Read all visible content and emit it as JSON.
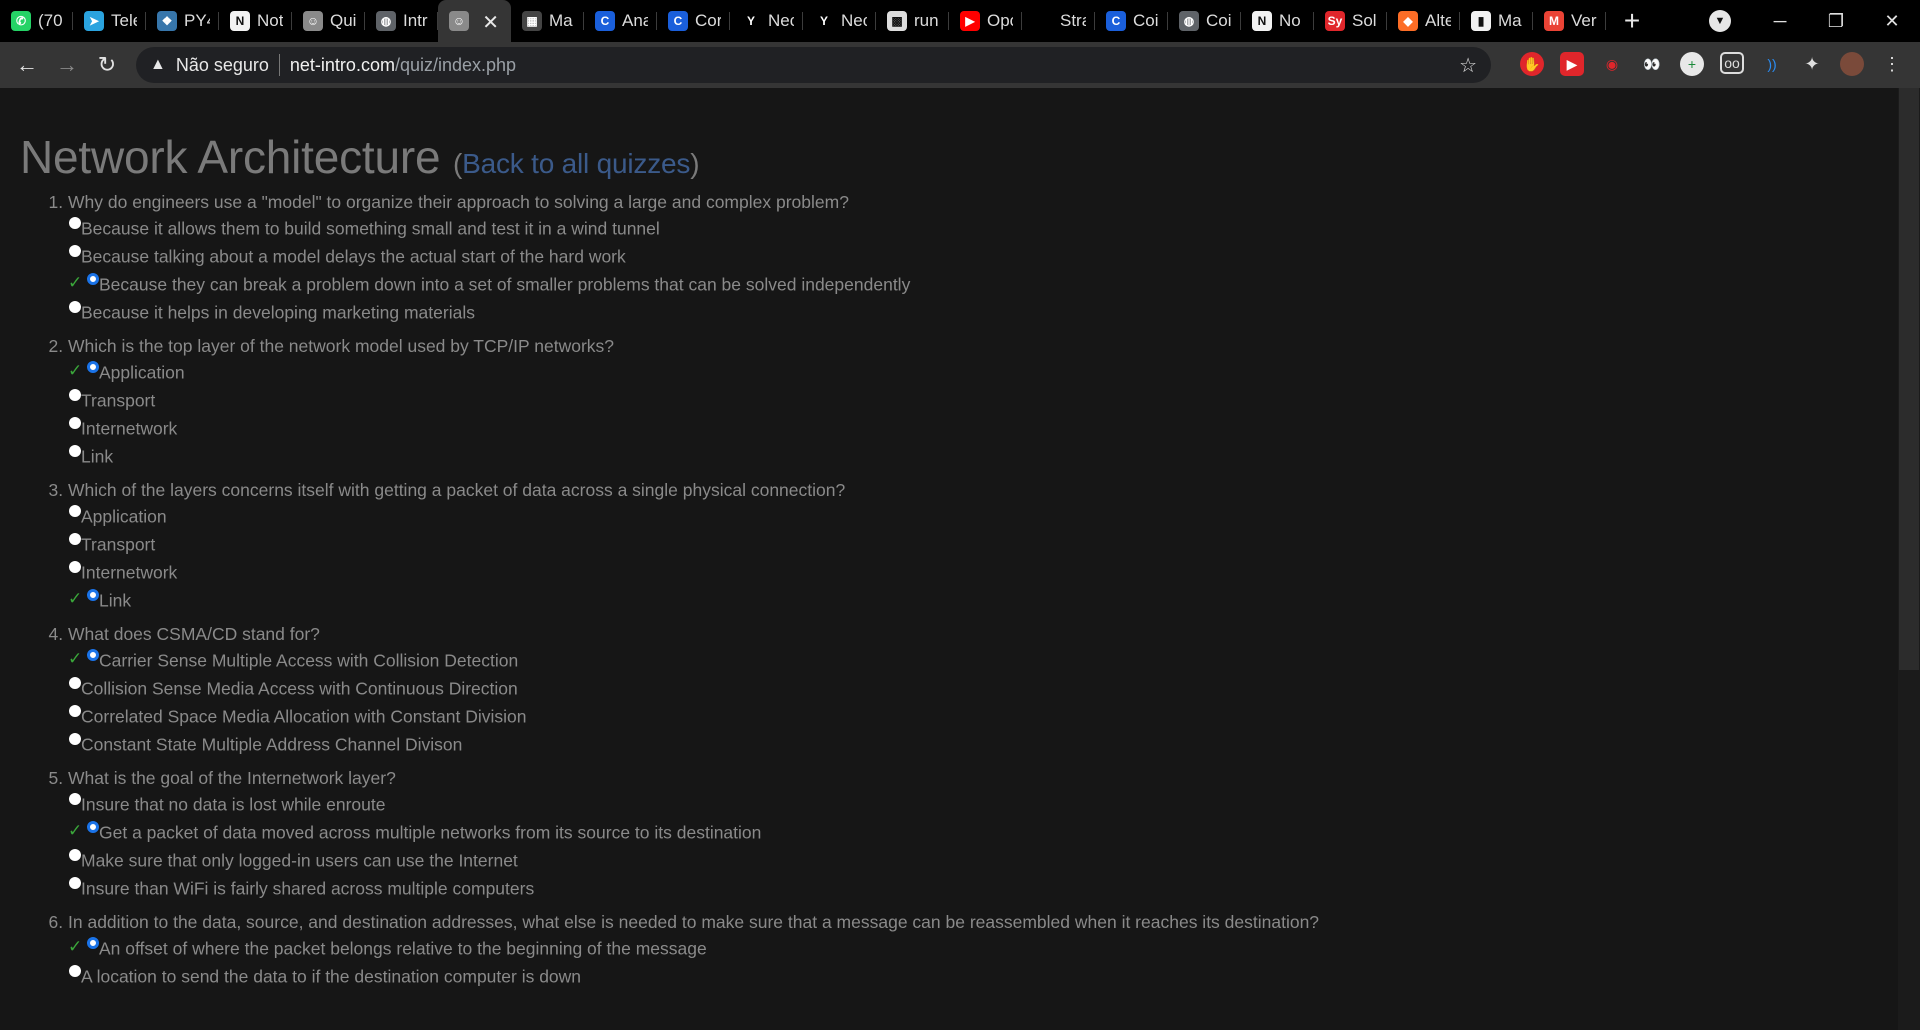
{
  "browser": {
    "tabs": [
      {
        "title": "(70",
        "favicon": "whatsapp-icon",
        "color": "#25d366",
        "glyph": "✆"
      },
      {
        "title": "Tele",
        "favicon": "telegram-icon",
        "color": "#2aa3df",
        "glyph": "➤"
      },
      {
        "title": "PY4",
        "favicon": "python-icon",
        "color": "#3776ab",
        "glyph": "❖"
      },
      {
        "title": "Not",
        "favicon": "notion-icon",
        "color": "#f2f2f2",
        "glyph": "N"
      },
      {
        "title": "Qui",
        "favicon": "avatar-icon",
        "color": "#8a8a8a",
        "glyph": "☺"
      },
      {
        "title": "Intr",
        "favicon": "globe-icon",
        "color": "#5f6368",
        "glyph": "◍"
      },
      {
        "title": "",
        "favicon": "avatar-icon",
        "color": "#8a8a8a",
        "glyph": "☺",
        "active": true
      },
      {
        "title": "Ma",
        "favicon": "film-icon",
        "color": "#444",
        "glyph": "▦"
      },
      {
        "title": "Ana",
        "favicon": "c-icon",
        "color": "#1a5fdb",
        "glyph": "C"
      },
      {
        "title": "Cor",
        "favicon": "c-icon",
        "color": "#1a5fdb",
        "glyph": "C"
      },
      {
        "title": "Nec",
        "favicon": "y-icon",
        "color": "#000",
        "glyph": "Y"
      },
      {
        "title": "Nec",
        "favicon": "y-icon",
        "color": "#000",
        "glyph": "Y"
      },
      {
        "title": "run",
        "favicon": "qr-icon",
        "color": "#ddd",
        "glyph": "▩"
      },
      {
        "title": "Opc",
        "favicon": "youtube-icon",
        "color": "#ff0000",
        "glyph": "▶"
      },
      {
        "title": "Stra",
        "favicon": "blank-icon",
        "color": "#000",
        "glyph": ""
      },
      {
        "title": "Coi",
        "favicon": "c-icon",
        "color": "#1a5fdb",
        "glyph": "C"
      },
      {
        "title": "Coi",
        "favicon": "globe-icon",
        "color": "#5f6368",
        "glyph": "◍"
      },
      {
        "title": "No",
        "favicon": "notion-icon",
        "color": "#f2f2f2",
        "glyph": "N"
      },
      {
        "title": "Sol",
        "favicon": "sy-icon",
        "color": "#e0262b",
        "glyph": "Sy"
      },
      {
        "title": "Alte",
        "favicon": "gitlab-icon",
        "color": "#fc6d26",
        "glyph": "◆"
      },
      {
        "title": "Ma",
        "favicon": "bookmark-icon",
        "color": "#f2f2f2",
        "glyph": "▮"
      },
      {
        "title": "Ver",
        "favicon": "gmail-icon",
        "color": "#ea4335",
        "glyph": "M"
      }
    ],
    "newtab": "+",
    "omnibox": {
      "security": "Não seguro",
      "host": "net-intro.com",
      "path": "/quiz/index.php"
    }
  },
  "page": {
    "title": "Network Architecture",
    "paren_open": "(",
    "back_link": "Back to all quizzes",
    "paren_close": ")",
    "check_mark": "✓"
  },
  "questions": [
    {
      "text": "Why do engineers use a \"model\" to organize their approach to solving a large and complex problem?",
      "options": [
        {
          "text": "Because it allows them to build something small and test it in a wind tunnel",
          "selected": false
        },
        {
          "text": "Because talking about a model delays the actual start of the hard work",
          "selected": false
        },
        {
          "text": "Because they can break a problem down into a set of smaller problems that can be solved independently",
          "selected": true
        },
        {
          "text": "Because it helps in developing marketing materials",
          "selected": false
        }
      ]
    },
    {
      "text": "Which is the top layer of the network model used by TCP/IP networks?",
      "options": [
        {
          "text": "Application",
          "selected": true
        },
        {
          "text": "Transport",
          "selected": false
        },
        {
          "text": "Internetwork",
          "selected": false
        },
        {
          "text": "Link",
          "selected": false
        }
      ]
    },
    {
      "text": "Which of the layers concerns itself with getting a packet of data across a single physical connection?",
      "options": [
        {
          "text": "Application",
          "selected": false
        },
        {
          "text": "Transport",
          "selected": false
        },
        {
          "text": "Internetwork",
          "selected": false
        },
        {
          "text": "Link",
          "selected": true
        }
      ]
    },
    {
      "text": "What does CSMA/CD stand for?",
      "options": [
        {
          "text": "Carrier Sense Multiple Access with Collision Detection",
          "selected": true
        },
        {
          "text": "Collision Sense Media Access with Continuous Direction",
          "selected": false
        },
        {
          "text": "Correlated Space Media Allocation with Constant Division",
          "selected": false
        },
        {
          "text": "Constant State Multiple Address Channel Divison",
          "selected": false
        }
      ]
    },
    {
      "text": "What is the goal of the Internetwork layer?",
      "options": [
        {
          "text": "Insure that no data is lost while enroute",
          "selected": false
        },
        {
          "text": "Get a packet of data moved across multiple networks from its source to its destination",
          "selected": true
        },
        {
          "text": "Make sure that only logged-in users can use the Internet",
          "selected": false
        },
        {
          "text": "Insure than WiFi is fairly shared across multiple computers",
          "selected": false
        }
      ]
    },
    {
      "text": "In addition to the data, source, and destination addresses, what else is needed to make sure that a message can be reassembled when it reaches its destination?",
      "options": [
        {
          "text": "An offset of where the packet belongs relative to the beginning of the message",
          "selected": true
        },
        {
          "text": "A location to send the data to if the destination computer is down",
          "selected": false
        }
      ]
    }
  ]
}
